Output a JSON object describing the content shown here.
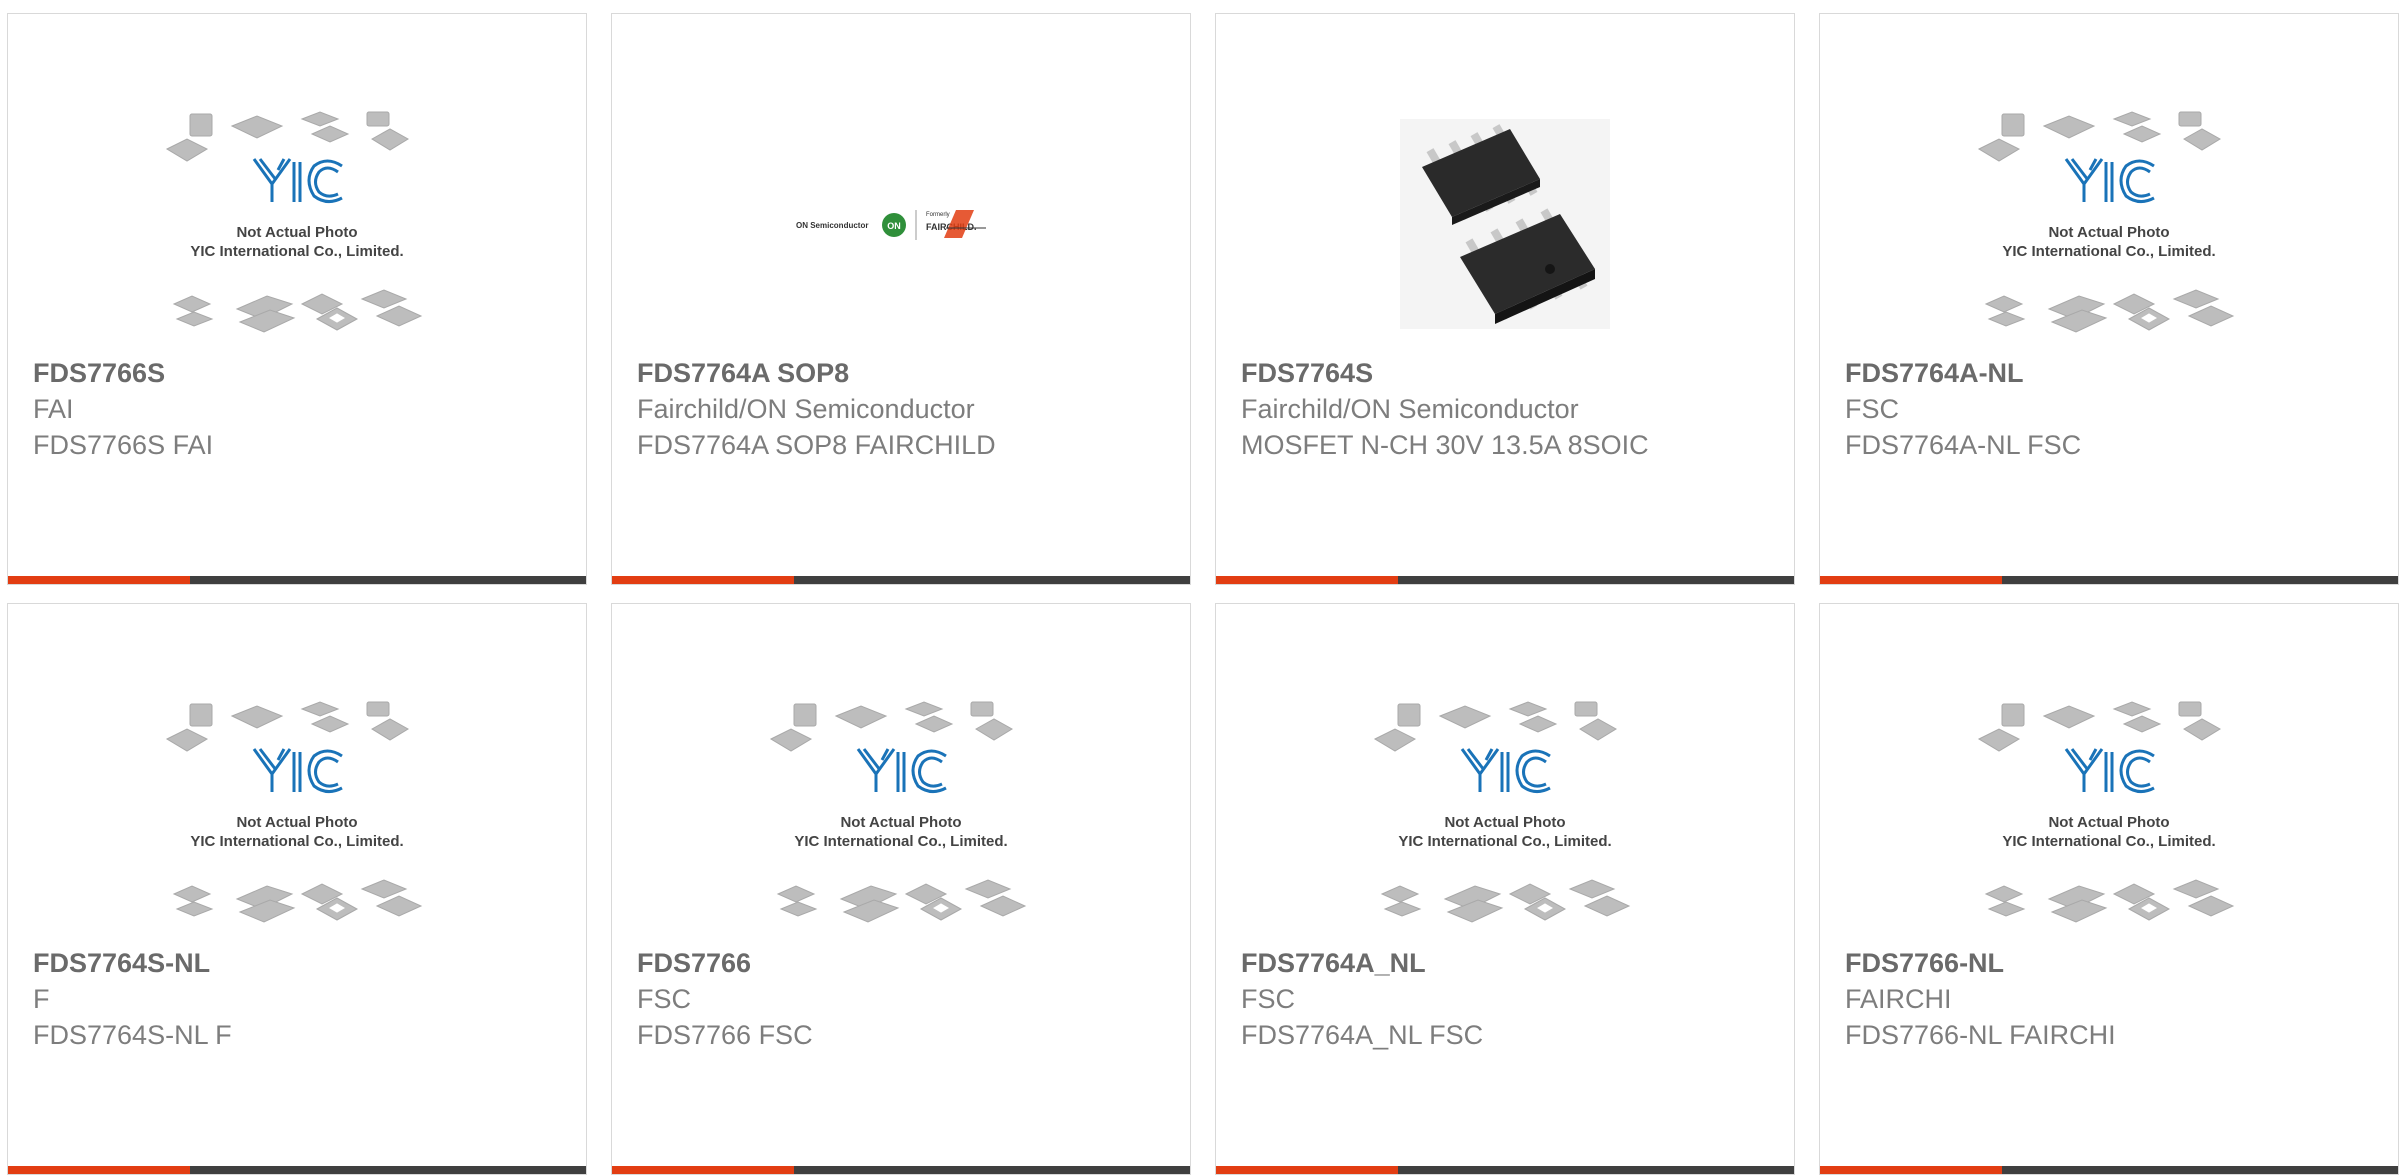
{
  "placeholder": {
    "line1": "Not Actual Photo",
    "line2": "YIC International Co., Limited.",
    "brand": "YIC"
  },
  "logo": {
    "left_text": "ON Semiconductor",
    "badge_text": "ON",
    "right_small": "Formerly",
    "right_big": "FAIRCHILD."
  },
  "colors": {
    "accent_bar": "#e23d12",
    "bar": "#3f3f3f",
    "yic_blue": "#1a73b8"
  },
  "products": [
    {
      "part": "FDS7766S",
      "maker": "FAI",
      "desc": "FDS7766S FAI",
      "image": "placeholder-icon"
    },
    {
      "part": "FDS7764A SOP8",
      "maker": "Fairchild/ON Semiconductor",
      "desc": "FDS7764A SOP8 FAIRCHILD",
      "image": "on-fairchild-logo"
    },
    {
      "part": "FDS7764S",
      "maker": "Fairchild/ON Semiconductor",
      "desc": "MOSFET N-CH 30V 13.5A 8SOIC",
      "image": "sop8-chip-photo"
    },
    {
      "part": "FDS7764A-NL",
      "maker": "FSC",
      "desc": "FDS7764A-NL FSC",
      "image": "placeholder-icon"
    },
    {
      "part": "FDS7764S-NL",
      "maker": "F",
      "desc": "FDS7764S-NL F",
      "image": "placeholder-icon"
    },
    {
      "part": "FDS7766",
      "maker": "FSC",
      "desc": "FDS7766 FSC",
      "image": "placeholder-icon"
    },
    {
      "part": "FDS7764A_NL",
      "maker": "FSC",
      "desc": "FDS7764A_NL FSC",
      "image": "placeholder-icon"
    },
    {
      "part": "FDS7766-NL",
      "maker": "FAIRCHI",
      "desc": "FDS7766-NL FAIRCHI",
      "image": "placeholder-icon"
    }
  ]
}
